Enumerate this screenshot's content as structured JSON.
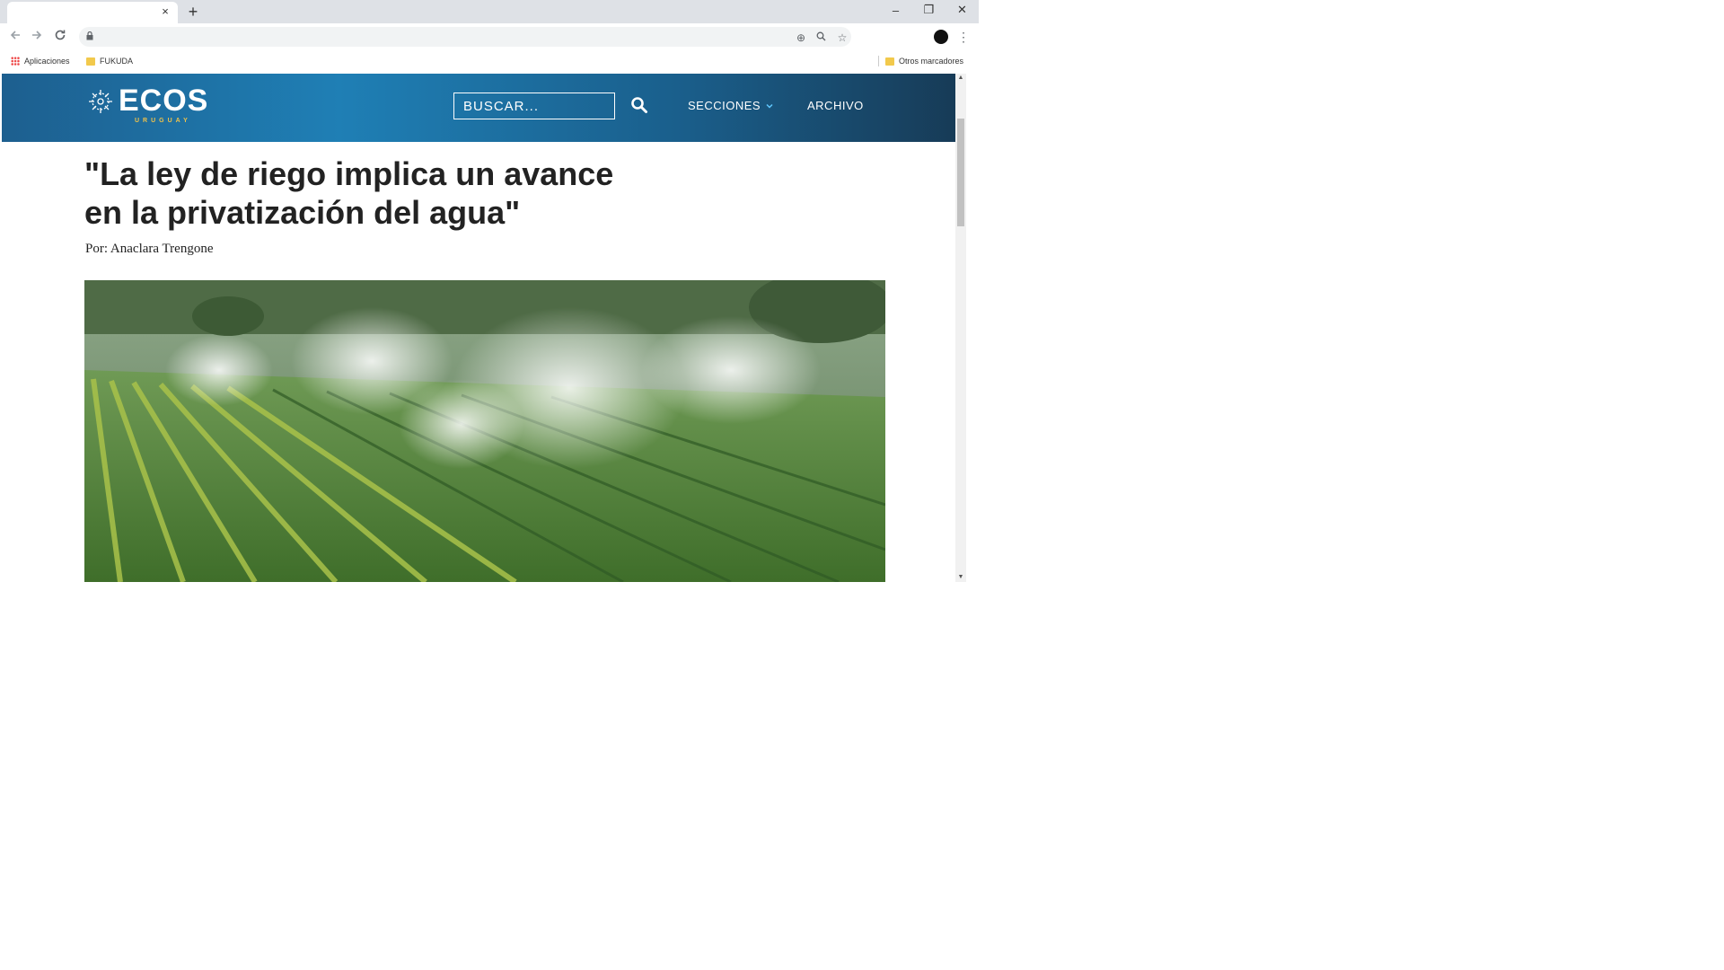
{
  "browser": {
    "tab_close_glyph": "×",
    "new_tab_glyph": "+",
    "window_controls": [
      "–",
      "❐",
      "✕"
    ],
    "bookmarks": {
      "apps": "Aplicaciones",
      "folder1": "FUKUDA",
      "other": "Otros marcadores"
    }
  },
  "site": {
    "logo": "ECOS",
    "logo_sub": "URUGUAY",
    "search_placeholder": "BUSCAR...",
    "nav_secciones": "SECCIONES",
    "nav_archivo": "ARCHIVO",
    "header_colors": [
      "#1d5f8f",
      "#1f7fb5",
      "#173a55"
    ]
  },
  "article": {
    "title": "\"La ley de riego implica un avance en la privatización del agua\"",
    "byline": "Por: Anaclara Trengone"
  },
  "icons": {
    "back": "arrow-left-icon",
    "forward": "arrow-right-icon",
    "reload": "reload-icon",
    "lock": "lock-icon",
    "search": "search-icon"
  }
}
